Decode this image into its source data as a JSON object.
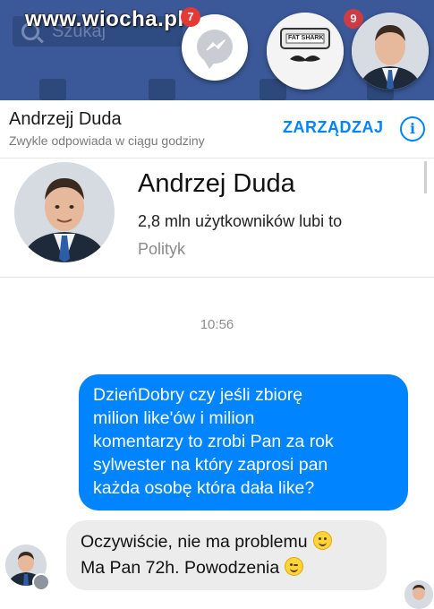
{
  "watermark": "www.wiocha.pl",
  "facebook_bar": {
    "search_placeholder": "Szukaj"
  },
  "chat_heads": {
    "messenger_badge": "7",
    "second_badge": "9",
    "meme_text": "FAT SHARK"
  },
  "conversation": {
    "name": "Andrzejj Duda",
    "subtitle": "Zwykle odpowiada w ciągu godziny",
    "manage_label": "ZARZĄDZAJ",
    "info_icon": "info-icon"
  },
  "profile": {
    "name": "Andrzej Duda",
    "likes": "2,8 mln użytkowników lubi to",
    "role": "Polityk"
  },
  "messages": {
    "timestamp": "10:56",
    "outgoing": {
      "lines": [
        "DzieńDobry czy jeśli zbiorę",
        "milion  like'ów i milion",
        "komentarzy to zrobi Pan za rok",
        "sylwester na który zaprosi pan",
        "każda osobę która dała like?"
      ]
    },
    "incoming": {
      "lines": [
        "Oczywiście, nie ma problemu",
        "Ma Pan 72h. Powodzenia"
      ]
    }
  },
  "colors": {
    "facebook_blue": "#3b5998",
    "messenger_blue": "#0084ff",
    "incoming_bubble": "#ececec",
    "badge_red": "#e53935"
  }
}
